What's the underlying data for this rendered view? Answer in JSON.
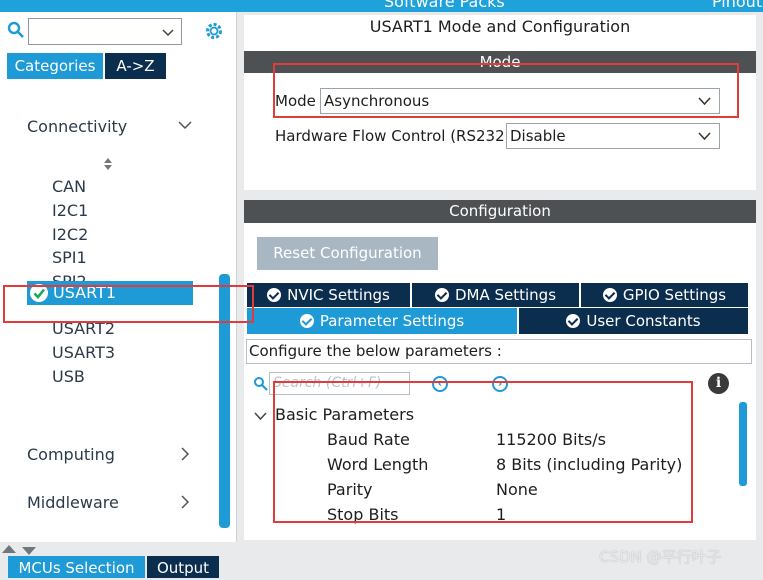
{
  "topbar": {
    "item1": "Software Packs",
    "item2": "Pinout"
  },
  "left": {
    "search": {
      "icon": "search-icon",
      "value": ""
    },
    "gear": "gear-icon",
    "tabs": [
      "Categories",
      "A->Z"
    ],
    "categories": {
      "connectivity": "Connectivity",
      "computing": "Computing",
      "middleware": "Middleware"
    },
    "peripherals": [
      "CAN",
      "I2C1",
      "I2C2",
      "SPI1",
      "SPI2",
      "USART1",
      "USART2",
      "USART3",
      "USB"
    ],
    "selected": "USART1"
  },
  "mode_panel": {
    "title": "USART1 Mode and Configuration",
    "section": "Mode",
    "mode_label": "Mode",
    "mode_value": "Asynchronous",
    "hw_flow_label": "Hardware Flow Control (RS232)",
    "hw_flow_value": "Disable"
  },
  "config_panel": {
    "section": "Configuration",
    "reset_button": "Reset Configuration",
    "tabs_row1": [
      "NVIC Settings",
      "DMA Settings",
      "GPIO Settings"
    ],
    "tabs_row2": [
      "Parameter Settings",
      "User Constants"
    ],
    "configure_text": "Configure the below parameters :",
    "search_placeholder": "Search (Ctrl+F)",
    "group": "Basic Parameters",
    "params": [
      {
        "name": "Baud Rate",
        "value": "115200 Bits/s"
      },
      {
        "name": "Word Length",
        "value": "8 Bits (including Parity)"
      },
      {
        "name": "Parity",
        "value": "None"
      },
      {
        "name": "Stop Bits",
        "value": "1"
      }
    ]
  },
  "bottom_tabs": [
    "MCUs Selection",
    "Output"
  ],
  "watermark": "CSDN @平行叶子",
  "colors": {
    "accent": "#1e9ad6",
    "dark": "#0b2e4e",
    "highlight": "#e23b3b"
  }
}
